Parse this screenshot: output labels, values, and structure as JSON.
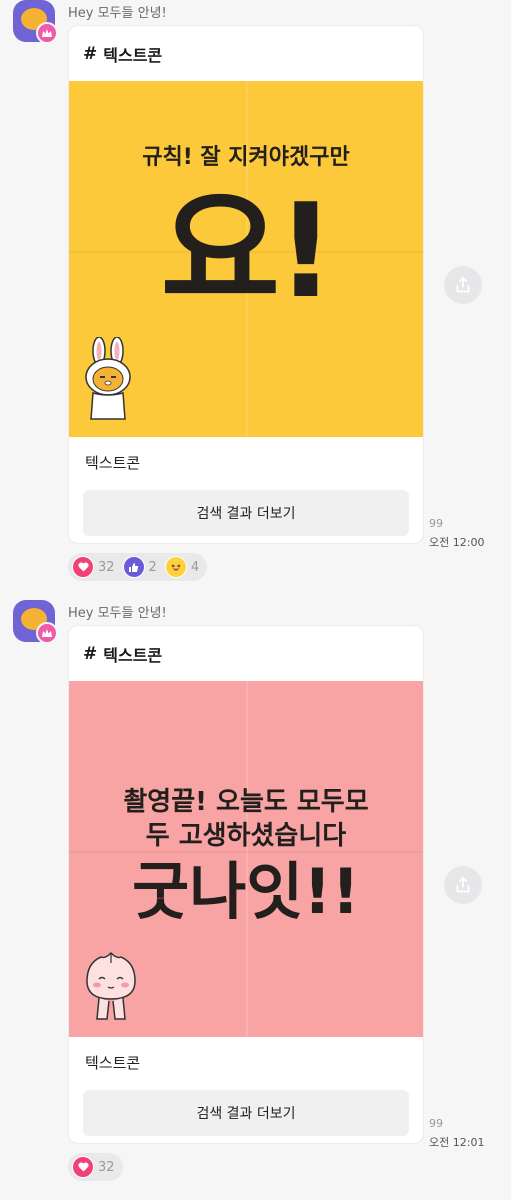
{
  "messages": [
    {
      "sender": "Hey 모두들 안녕!",
      "card_header": "텍스트콘",
      "hash": "#",
      "sticker_lines": [
        "규칙! 잘 지켜야겠구만",
        "요!"
      ],
      "title": "텍스트콘",
      "button": "검색 결과 더보기",
      "unread": "99",
      "time": "오전 12:00",
      "reactions": [
        {
          "icon": "heart-icon",
          "count": "32"
        },
        {
          "icon": "thumbs-up-icon",
          "count": "2"
        },
        {
          "icon": "laughing-face-icon",
          "count": "4"
        }
      ]
    },
    {
      "sender": "Hey 모두들 안녕!",
      "card_header": "텍스트콘",
      "hash": "#",
      "sticker_lines": [
        "촬영끝! 오늘도 모두모",
        "두 고생하셨습니다",
        "굿나잇!!"
      ],
      "title": "텍스트콘",
      "button": "검색 결과 더보기",
      "unread": "99",
      "time": "오전 12:01",
      "reactions": [
        {
          "icon": "heart-icon",
          "count": "32"
        }
      ]
    }
  ],
  "colors": {
    "sticker1_bg": "#fcc93a",
    "sticker2_bg": "#f9a4a4",
    "heart": "#f14277",
    "like": "#6a5bd6",
    "avatar": "#6f63d6"
  }
}
